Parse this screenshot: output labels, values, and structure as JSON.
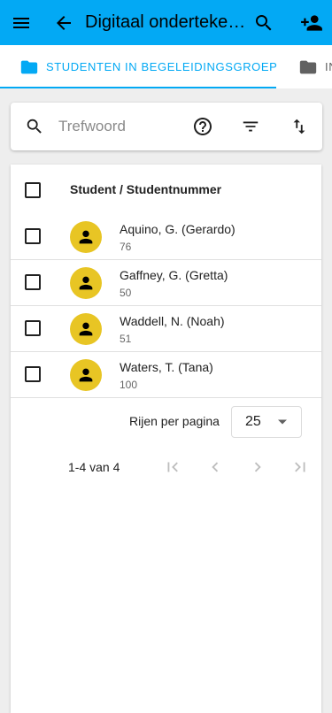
{
  "app_bar": {
    "title": "Digitaal ondertekenen",
    "menu_icon": "menu-icon",
    "back_icon": "arrow-back-icon",
    "search_icon": "search-icon",
    "add_person_icon": "person-add-icon",
    "background_color": "#03a9f4"
  },
  "tabs": [
    {
      "label": "STUDENTEN IN BEGELEIDINGSGROEP",
      "icon": "folder-icon",
      "active": true,
      "color": "#03a9f4"
    },
    {
      "label": "IN",
      "icon": "folder-icon",
      "active": false,
      "color": "#616161"
    }
  ],
  "search": {
    "placeholder": "Trefwoord",
    "value": "",
    "help_icon": "help-circle-icon",
    "filter_icon": "filter-icon",
    "sort_icon": "sort-icon"
  },
  "table": {
    "column_header": "Student / Studentnummer",
    "rows": [
      {
        "name": "Aquino, G. (Gerardo)",
        "number": "76"
      },
      {
        "name": "Gaffney, G. (Gretta)",
        "number": "50"
      },
      {
        "name": "Waddell, N. (Noah)",
        "number": "51"
      },
      {
        "name": "Waters, T. (Tana)",
        "number": "100"
      }
    ],
    "avatar_color": "#e8c524"
  },
  "pagination": {
    "rows_per_page_label": "Rijen per pagina",
    "rows_per_page_value": "25",
    "range_text": "1-4 van 4"
  }
}
